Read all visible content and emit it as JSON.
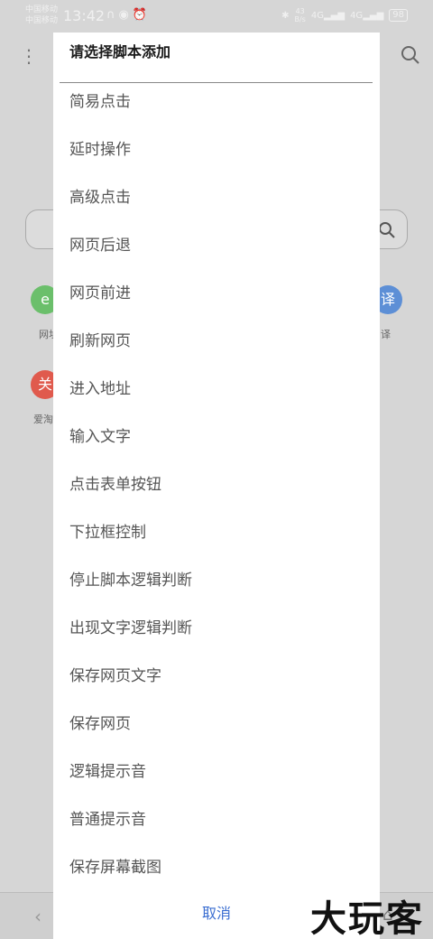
{
  "status_bar": {
    "carrier_1": "中国移动",
    "carrier_2": "中国移动",
    "time": "13:42",
    "net_speed_value": "43",
    "net_speed_unit": "B/s",
    "signal_1": "4G",
    "signal_2": "4G",
    "battery": "98"
  },
  "background": {
    "app_1_glyph": "e",
    "app_1_label": "网址",
    "app_2_glyph": "译",
    "app_2_label": "译",
    "app_3_glyph": "关",
    "app_3_label": "爱淘",
    "colors": {
      "green": "#6bbf6b",
      "blue": "#5d8fd6",
      "red": "#e05a4d"
    }
  },
  "dialog": {
    "title": "请选择脚本添加",
    "options": [
      "简易点击",
      "延时操作",
      "高级点击",
      "网页后退",
      "网页前进",
      "刷新网页",
      "进入地址",
      "输入文字",
      "点击表单按钮",
      "下拉框控制",
      "停止脚本逻辑判断",
      "出现文字逻辑判断",
      "保存网页文字",
      "保存网页",
      "逻辑提示音",
      "普通提示音",
      "保存屏幕截图"
    ],
    "cancel_label": "取消",
    "accent_color": "#3b6ed1"
  },
  "watermark": "大玩客"
}
